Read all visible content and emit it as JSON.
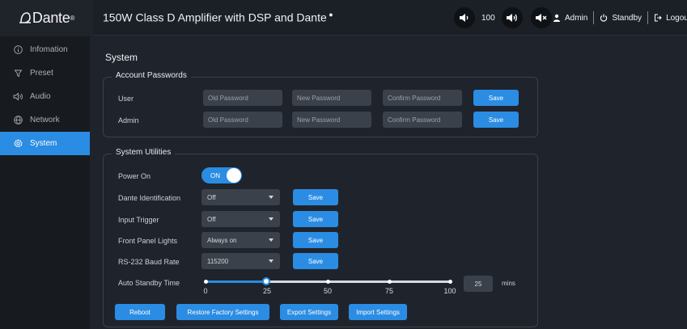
{
  "header": {
    "logo": "Dante",
    "title": "150W Class D Amplifier with DSP and Dante",
    "volume_value": "100",
    "user_label": "Admin",
    "standby_label": "Standby",
    "logout_label": "Logout"
  },
  "sidebar": {
    "items": [
      {
        "label": "Infomation",
        "icon": "info-icon"
      },
      {
        "label": "Preset",
        "icon": "preset-icon"
      },
      {
        "label": "Audio",
        "icon": "audio-icon"
      },
      {
        "label": "Network",
        "icon": "globe-icon"
      },
      {
        "label": "System",
        "icon": "gear-icon",
        "active": true
      }
    ]
  },
  "main": {
    "title": "System",
    "passwords": {
      "title": "Account Passwords",
      "rows": [
        {
          "label": "User",
          "old_placeholder": "Old Password",
          "new_placeholder": "New Password",
          "confirm_placeholder": "Confirm Password",
          "save_label": "Save"
        },
        {
          "label": "Admin",
          "old_placeholder": "Old Password",
          "new_placeholder": "New Password",
          "confirm_placeholder": "Confirm Password",
          "save_label": "Save"
        }
      ]
    },
    "utilities": {
      "title": "System Utilities",
      "power_on": {
        "label": "Power On",
        "state": "ON"
      },
      "dante_identification": {
        "label": "Dante Identification",
        "value": "Off",
        "save_label": "Save"
      },
      "input_trigger": {
        "label": "Input Trigger",
        "value": "Off",
        "save_label": "Save"
      },
      "front_panel_lights": {
        "label": "Front Panel Lights",
        "value": "Always on",
        "save_label": "Save"
      },
      "baud_rate": {
        "label": "RS-232 Baud Rate",
        "value": "115200",
        "save_label": "Save"
      },
      "auto_standby": {
        "label": "Auto Standby Time",
        "value": 25,
        "ticks": [
          "0",
          "25",
          "50",
          "75",
          "100"
        ],
        "box_value": "25",
        "unit": "mins"
      },
      "actions": {
        "reboot": "Reboot",
        "restore": "Restore Factory Settings",
        "export": "Export Settings",
        "import": "Import Settings"
      }
    }
  },
  "colors": {
    "accent": "#2b8ce3",
    "background": "#1f242c",
    "sidebar": "#171a1f"
  }
}
